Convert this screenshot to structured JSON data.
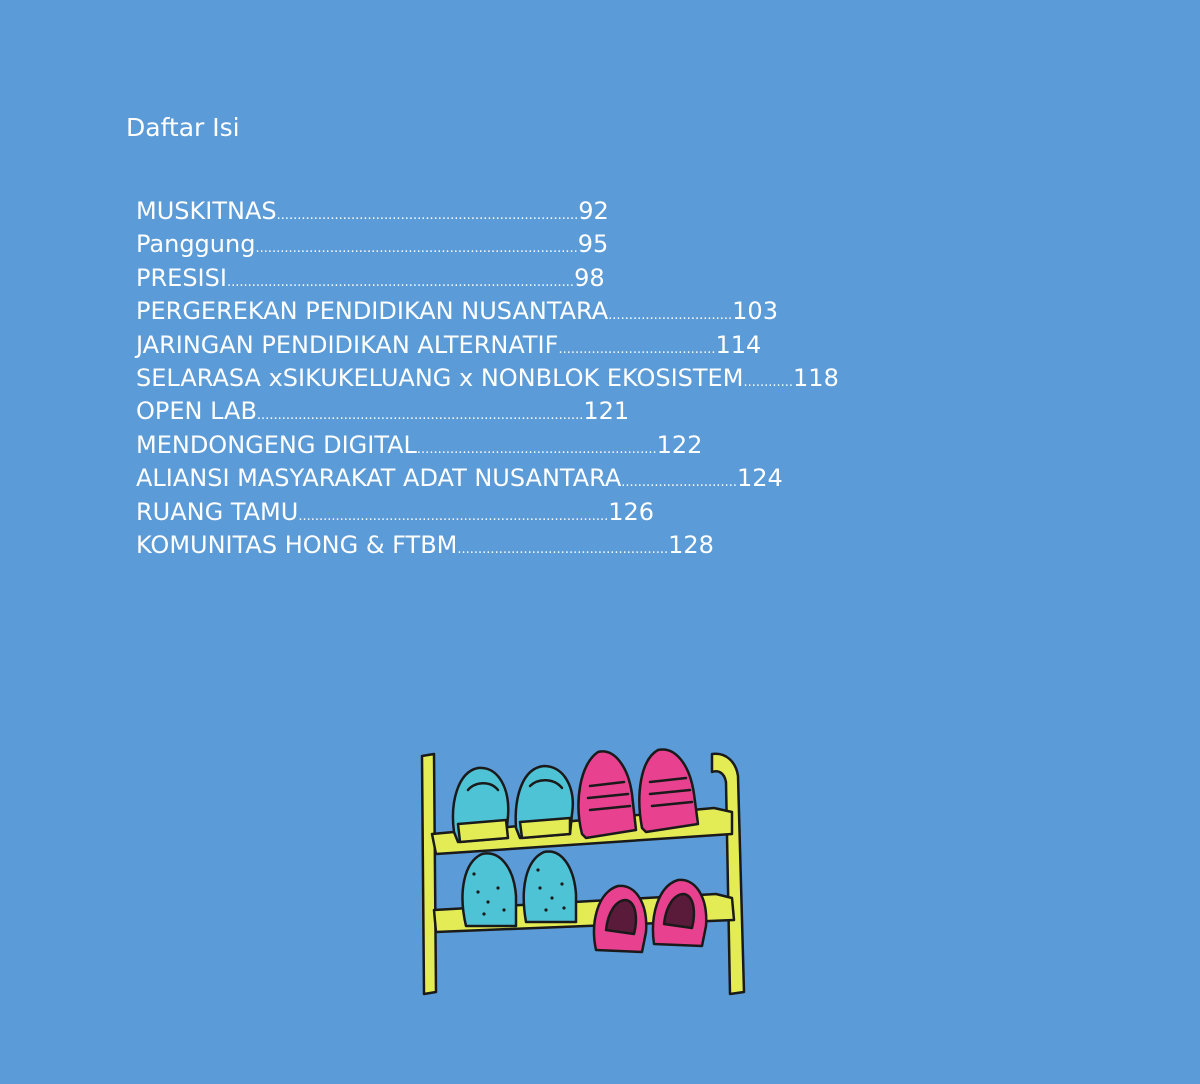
{
  "page": {
    "heading": "Daftar Isi"
  },
  "toc": {
    "entries": [
      {
        "title": "MUSKITNAS",
        "dots": ".........................................................................",
        "page": "92"
      },
      {
        "title": "Panggung",
        "dots": "..............................................................................",
        "page": "95"
      },
      {
        "title": "PRESISI",
        "dots": "....................................................................................",
        "page": "98"
      },
      {
        "title": "PERGEREKAN PENDIDIKAN NUSANTARA",
        "dots": "..............................",
        "page": "103"
      },
      {
        "title": "JARINGAN PENDIDIKAN ALTERNATIF",
        "dots": "......................................",
        "page": "114"
      },
      {
        "title": "SELARASA xSIKUKELUANG x NONBLOK EKOSISTEM",
        "dots": "............",
        "page": "118"
      },
      {
        "title": "OPEN LAB",
        "dots": "...............................................................................",
        "page": "121"
      },
      {
        "title": "MENDONGENG DIGITAL",
        "dots": "..........................................................",
        "page": "122"
      },
      {
        "title": "ALIANSI MASYARAKAT ADAT NUSANTARA",
        "dots": "............................",
        "page": "124"
      },
      {
        "title": "RUANG TAMU",
        "dots": "...........................................................................",
        "page": "126"
      },
      {
        "title": "KOMUNITAS HONG & FTBM",
        "dots": "...................................................",
        "page": "128"
      }
    ]
  },
  "illustration": {
    "icon": "shoe-rack-icon",
    "colors": {
      "background": "#5b9bd7",
      "rack": "#e4ec55",
      "teal_shoe": "#4fc3d6",
      "pink_shoe": "#e8418f",
      "outline": "#1a1a1a"
    }
  }
}
